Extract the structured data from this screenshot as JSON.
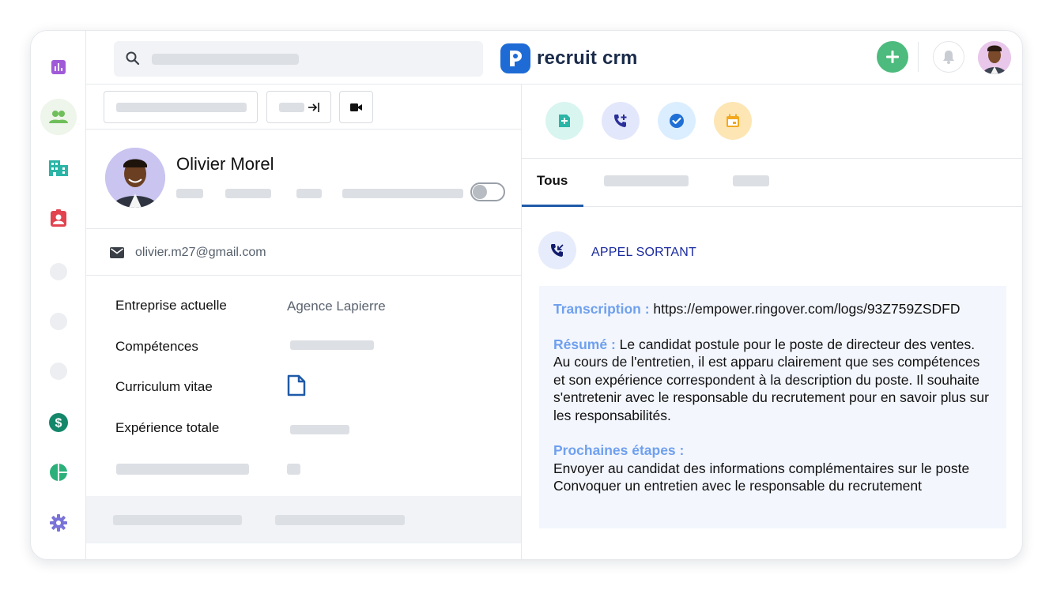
{
  "brand": {
    "name": "recruit crm"
  },
  "sidebar": {
    "items": [
      {
        "icon": "bar-chart-icon",
        "color": "#a05ad8"
      },
      {
        "icon": "people-icon",
        "color": "#6fbf5a",
        "active": true
      },
      {
        "icon": "building-icon",
        "color": "#2bb5a7"
      },
      {
        "icon": "id-badge-icon",
        "color": "#e2434f"
      },
      {
        "icon": "placeholder-dot"
      },
      {
        "icon": "placeholder-dot"
      },
      {
        "icon": "placeholder-dot"
      },
      {
        "icon": "dollar-icon",
        "color": "#14876a"
      },
      {
        "icon": "pie-chart-icon",
        "color": "#2bb07a"
      },
      {
        "icon": "gear-icon",
        "color": "#7a73d8"
      }
    ]
  },
  "profile": {
    "name": "Olivier Morel",
    "email": "olivier.m27@gmail.com",
    "fields": [
      {
        "label": "Entreprise actuelle",
        "value": "Agence Lapierre"
      },
      {
        "label": "Compétences",
        "value": ""
      },
      {
        "label": "Curriculum vitae",
        "value": ""
      },
      {
        "label": "Expérience totale",
        "value": ""
      }
    ]
  },
  "activity": {
    "tabs": [
      {
        "label": "Tous",
        "active": true
      }
    ],
    "action_colors": [
      "#d8f5f0",
      "#e3e7fb",
      "#dbeeff",
      "#fde6b4"
    ],
    "call_type": "APPEL SORTANT",
    "note": {
      "transcription_label": "Transcription :",
      "transcription_value": "https://empower.ringover.com/logs/93Z759ZSDFD",
      "summary_label": "Résumé :",
      "summary_value": "Le candidat postule pour le poste de directeur des ventes. Au cours de l'entretien, il est apparu clairement que ses compétences et son expérience correspondent à la description du poste. Il souhaite s'entretenir avec le responsable du recrutement pour en savoir plus sur les responsabilités.",
      "next_steps_label": "Prochaines étapes :",
      "next_steps": [
        "Envoyer au candidat des informations complémentaires sur le poste",
        "Convoquer un entretien avec le responsable du recrutement"
      ]
    }
  }
}
